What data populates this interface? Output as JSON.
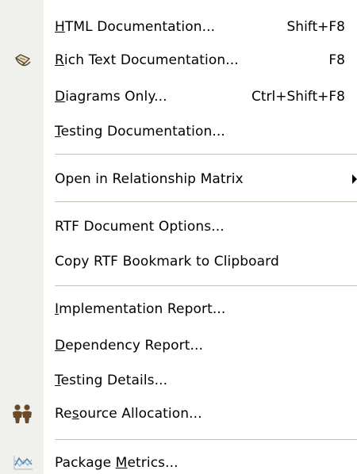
{
  "menu": {
    "items": [
      {
        "pre": "",
        "ul": "H",
        "post": "TML Documentation...",
        "shortcut": "Shift+F8"
      },
      {
        "pre": "",
        "ul": "R",
        "post": "ich Text Documentation...",
        "shortcut": "F8",
        "icon": "rich-text-document-icon"
      },
      {
        "pre": "",
        "ul": "D",
        "post": "iagrams Only...",
        "shortcut": "Ctrl+Shift+F8"
      },
      {
        "pre": "",
        "ul": "T",
        "post": "esting Documentation..."
      },
      {
        "pre": "Open in Relationship Matrix",
        "ul": "",
        "post": "",
        "submenu": true
      },
      {
        "pre": "RTF Document Options...",
        "ul": "",
        "post": ""
      },
      {
        "pre": "Copy RTF Bookmark to Clipboard",
        "ul": "",
        "post": ""
      },
      {
        "pre": "",
        "ul": "I",
        "post": "mplementation Report..."
      },
      {
        "pre": "",
        "ul": "D",
        "post": "ependency Report..."
      },
      {
        "pre": "",
        "ul": "T",
        "post": "esting Details..."
      },
      {
        "pre": "Re",
        "ul": "s",
        "post": "ource Allocation...",
        "icon": "people-icon"
      },
      {
        "pre": "Package ",
        "ul": "M",
        "post": "etrics...",
        "icon": "metrics-chart-icon"
      }
    ]
  }
}
